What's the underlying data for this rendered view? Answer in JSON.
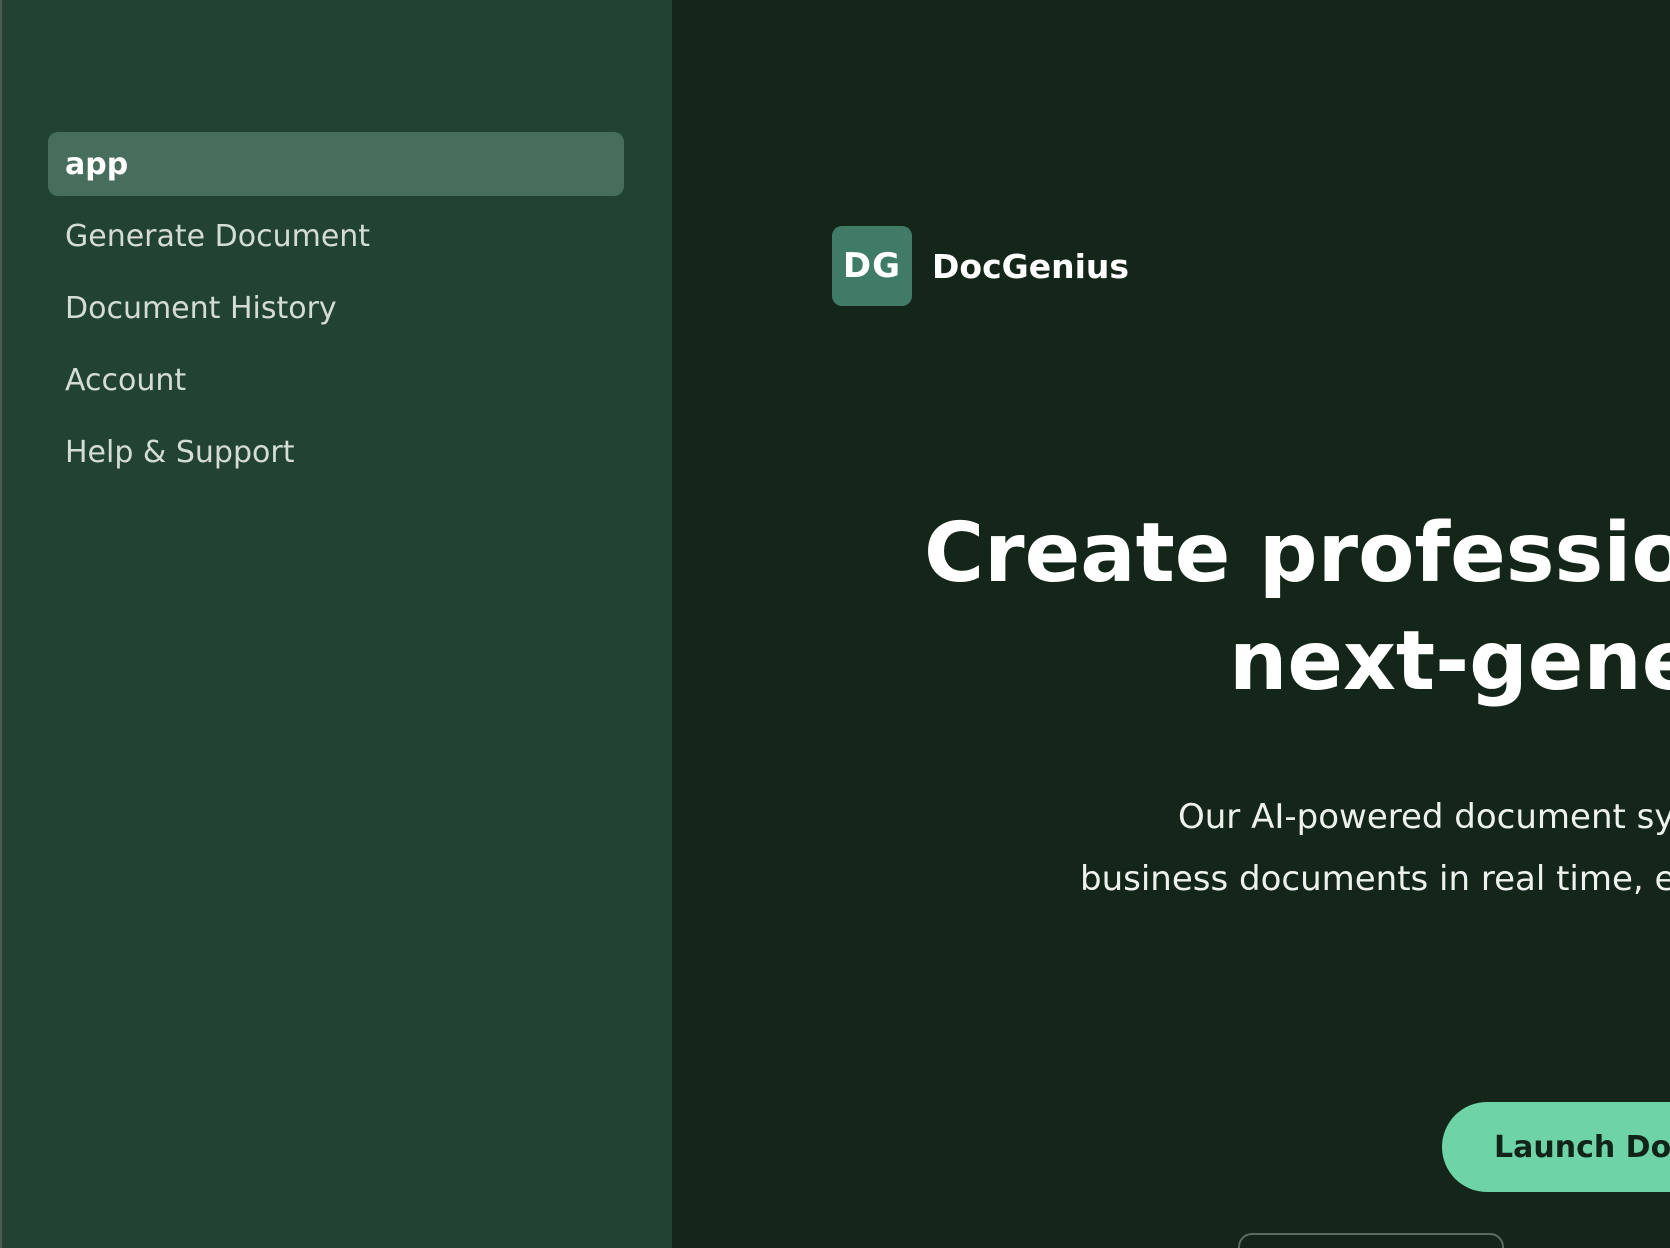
{
  "sidebar": {
    "items": [
      {
        "label": "app",
        "active": true
      },
      {
        "label": "Generate Document",
        "active": false
      },
      {
        "label": "Document History",
        "active": false
      },
      {
        "label": "Account",
        "active": false
      },
      {
        "label": "Help & Support",
        "active": false
      }
    ]
  },
  "main": {
    "brand": {
      "initials": "DG",
      "name": "DocGenius"
    },
    "headline": {
      "line1": "Create professional",
      "line2": "next-genera"
    },
    "subtitle": {
      "line1": "Our AI-powered document syst",
      "line2": "business documents in real time, ens"
    },
    "launch_button": "Launch DocG"
  },
  "colors": {
    "sidebar_bg": "#224232",
    "main_bg": "#142619",
    "active_item_bg": "#476e5c",
    "accent": "#6fd3a8",
    "brand_badge": "#3f7b66"
  }
}
